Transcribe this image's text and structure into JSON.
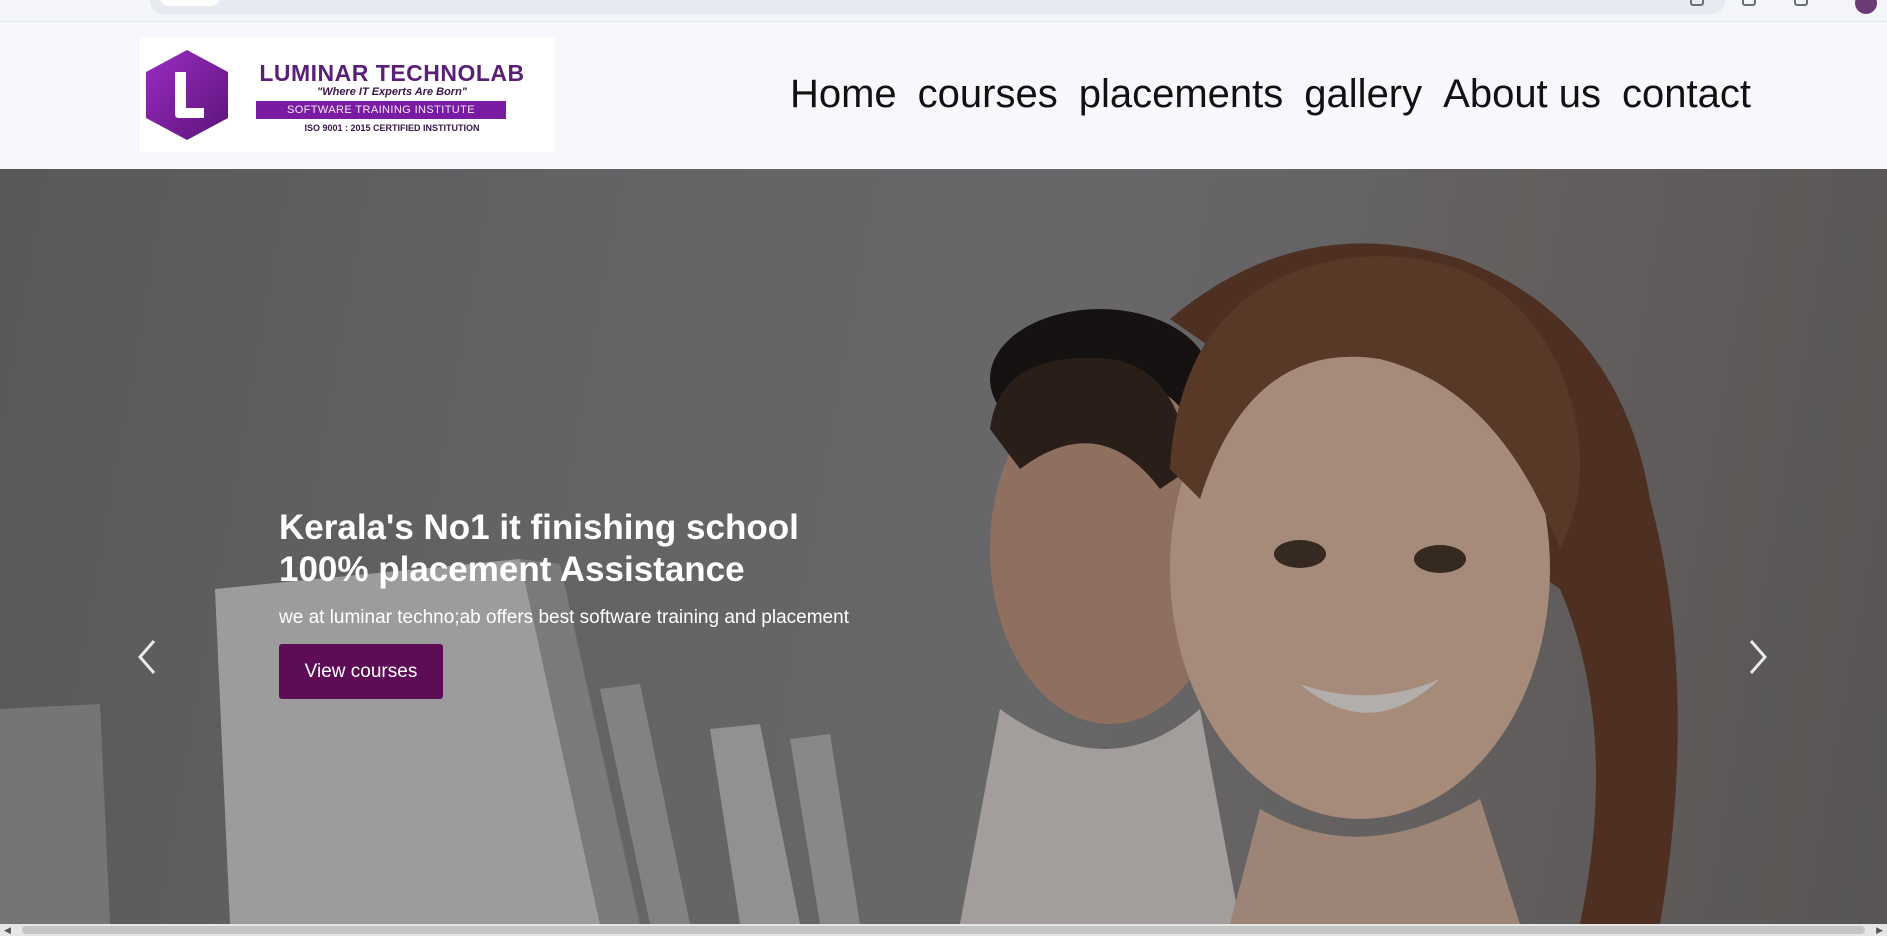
{
  "header": {
    "logo": {
      "title": "LUMINAR TECHNOLAB",
      "tagline": "\"Where IT Experts Are Born\"",
      "band": "SOFTWARE TRAINING INSTITUTE",
      "iso": "ISO 9001 : 2015 CERTIFIED INSTITUTION",
      "color": "#7a1ca3"
    },
    "nav": [
      {
        "label": "Home"
      },
      {
        "label": "courses"
      },
      {
        "label": "placements"
      },
      {
        "label": "gallery"
      },
      {
        "label": "About us"
      },
      {
        "label": "contact"
      }
    ]
  },
  "hero": {
    "title_line1": "Kerala's No1 it finishing school",
    "title_line2": "100% placement Assistance",
    "subtitle": "we at luminar techno;ab offers best software training and placement",
    "button_label": "View courses",
    "button_color": "#5c0d55",
    "prev_icon": "chevron-left-icon",
    "next_icon": "chevron-right-icon"
  }
}
